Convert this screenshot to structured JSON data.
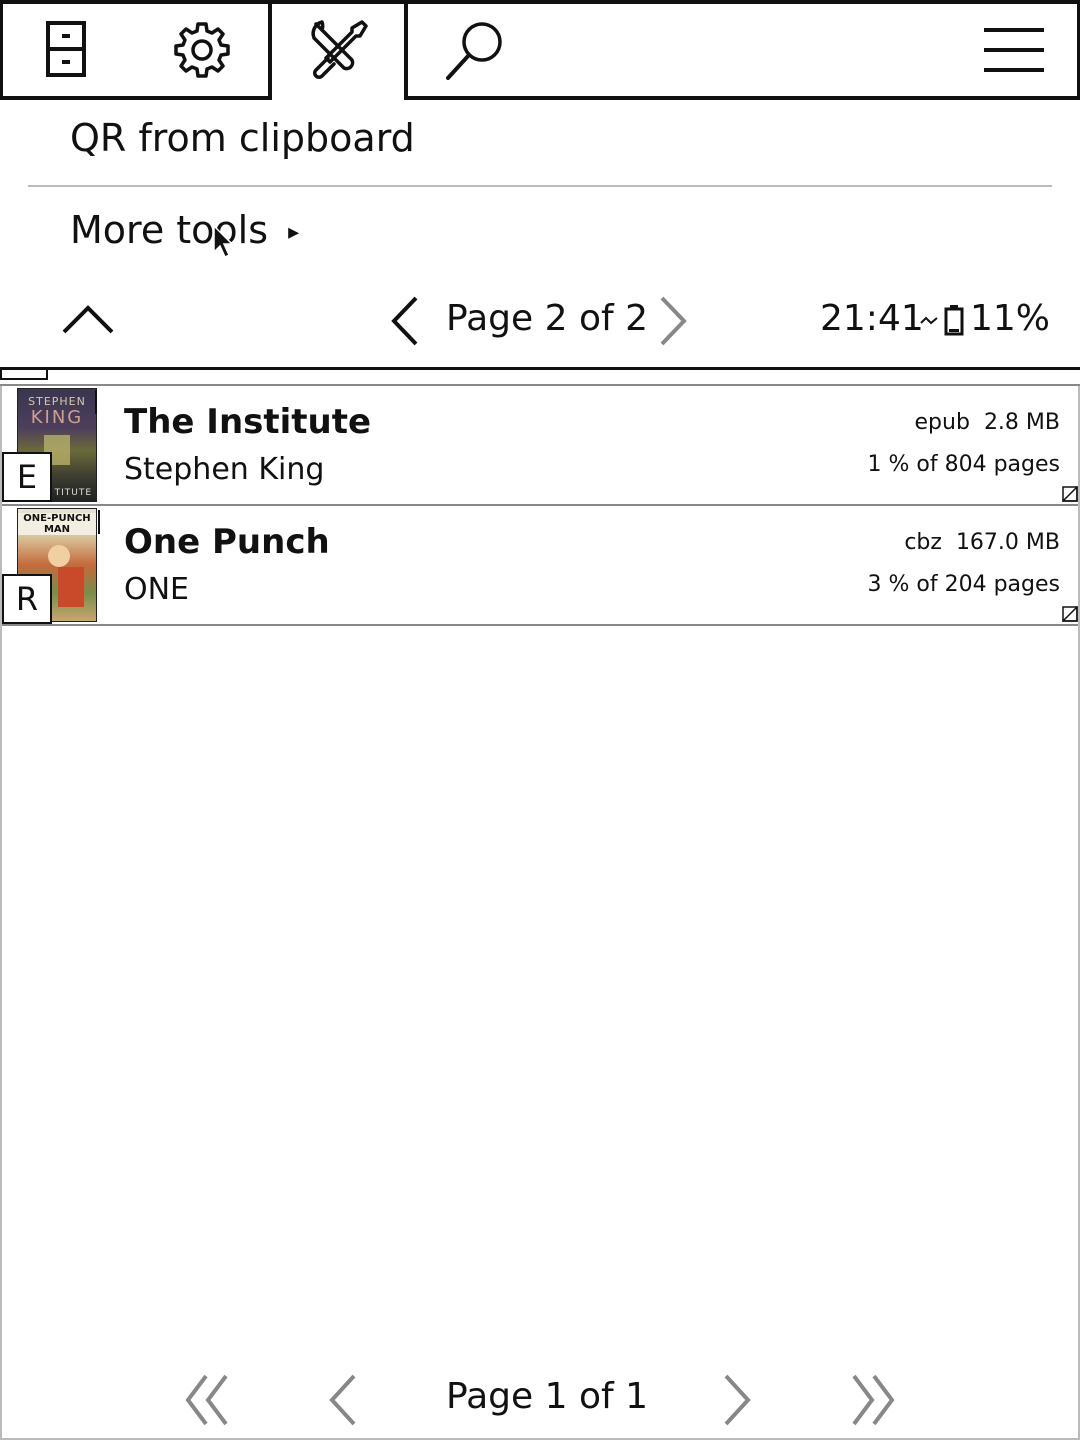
{
  "toolbar": {
    "tabs": [
      {
        "icon": "filing-cabinet-icon"
      },
      {
        "icon": "gear-icon"
      },
      {
        "icon": "tools-icon",
        "active": true
      },
      {
        "icon": "search-icon"
      }
    ],
    "menu_icon": "hamburger-menu-icon"
  },
  "menu": {
    "items": [
      {
        "label": "QR from clipboard"
      },
      {
        "label": "More tools",
        "submenu_arrow": "▸"
      }
    ],
    "pager": {
      "text": "Page 2 of 2"
    }
  },
  "status": {
    "time": "21:41",
    "battery": "11%"
  },
  "books": [
    {
      "title": "The Institute",
      "author": "Stephen King",
      "format": "epub",
      "size": "2.8 MB",
      "progress": "1 % of 804 pages",
      "badge": "E",
      "cover_top": "STEPHEN",
      "cover_mid": "KING",
      "cover_bottom": "TITUTE"
    },
    {
      "title": "One Punch",
      "author": "ONE",
      "format": "cbz",
      "size": "167.0 MB",
      "progress": "3 % of 204 pages",
      "badge": "R",
      "cover_top": "ONE-PUNCH MAN"
    }
  ],
  "footer": {
    "pager": "Page 1 of 1"
  }
}
